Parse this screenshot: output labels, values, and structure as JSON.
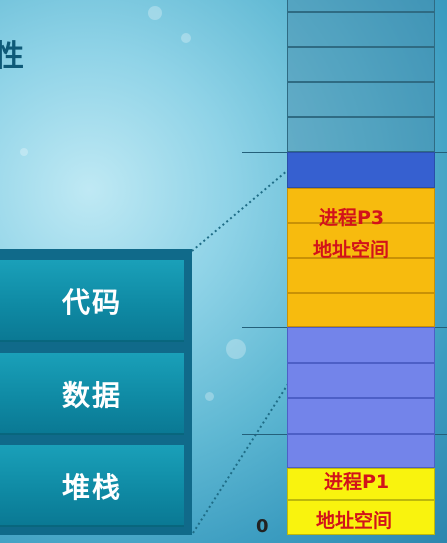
{
  "title_fragment": "性",
  "segments": [
    {
      "label": "代码"
    },
    {
      "label": "数据"
    },
    {
      "label": "堆栈"
    }
  ],
  "memory": {
    "p3_label_line1": "进程P3",
    "p3_label_line2": "地址空间",
    "p1_label_line1": "进程P1",
    "p1_label_line2": "地址空间",
    "zero_label": "0"
  }
}
